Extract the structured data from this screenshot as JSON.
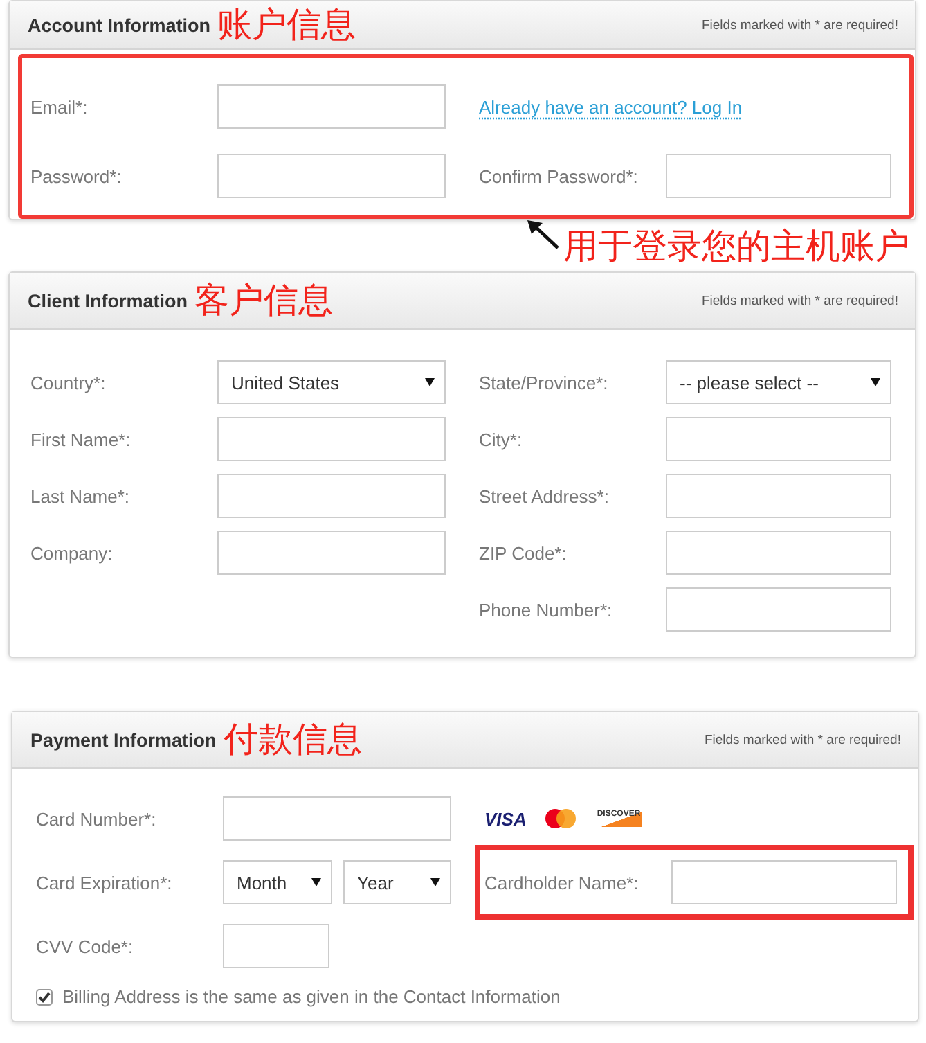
{
  "sections": [
    {
      "title": "Account Information",
      "annotation": "账户信息",
      "note": "Fields marked with * are required!",
      "highlighted": true,
      "rows": [
        [
          {
            "kind": "text",
            "label": "Email*:"
          },
          {
            "kind": "link",
            "text": "Already have an account? Log In"
          }
        ],
        [
          {
            "kind": "text",
            "label": "Password*:"
          },
          {
            "kind": "text",
            "label": "Confirm Password*:"
          }
        ]
      ],
      "callout": "用于登录您的主机账户"
    },
    {
      "title": "Client Information",
      "annotation": "客户信息",
      "note": "Fields marked with * are required!",
      "highlighted": false,
      "rows": [
        [
          {
            "kind": "select",
            "label": "Country*:",
            "value": "United States"
          },
          {
            "kind": "select",
            "label": "State/Province*:",
            "value": "-- please select --"
          }
        ],
        [
          {
            "kind": "text",
            "label": "First Name*:"
          },
          {
            "kind": "text",
            "label": "City*:"
          }
        ],
        [
          {
            "kind": "text",
            "label": "Last Name*:"
          },
          {
            "kind": "text",
            "label": "Street Address*:"
          }
        ],
        [
          {
            "kind": "text",
            "label": "Company:"
          },
          {
            "kind": "text",
            "label": "ZIP Code*:"
          }
        ],
        [
          {
            "kind": "empty"
          },
          {
            "kind": "text",
            "label": "Phone Number*:"
          }
        ]
      ]
    },
    {
      "title": "Payment Information",
      "annotation": "付款信息",
      "note": "Fields marked with * are required!",
      "highlighted": false,
      "rows": [
        [
          {
            "kind": "text",
            "label": "Card Number*:"
          },
          {
            "kind": "logos",
            "logos": [
              "VISA",
              "DISCOVER"
            ]
          }
        ],
        [
          {
            "kind": "expiry",
            "label": "Card Expiration*:",
            "month": "Month",
            "year": "Year"
          },
          {
            "kind": "text",
            "label": "Cardholder Name*:",
            "highlighted": true
          }
        ],
        [
          {
            "kind": "short",
            "label": "CVV Code*:"
          }
        ]
      ],
      "checkbox": {
        "label": "Billing Address is the same as given in the Contact Information",
        "checked": true
      }
    }
  ]
}
